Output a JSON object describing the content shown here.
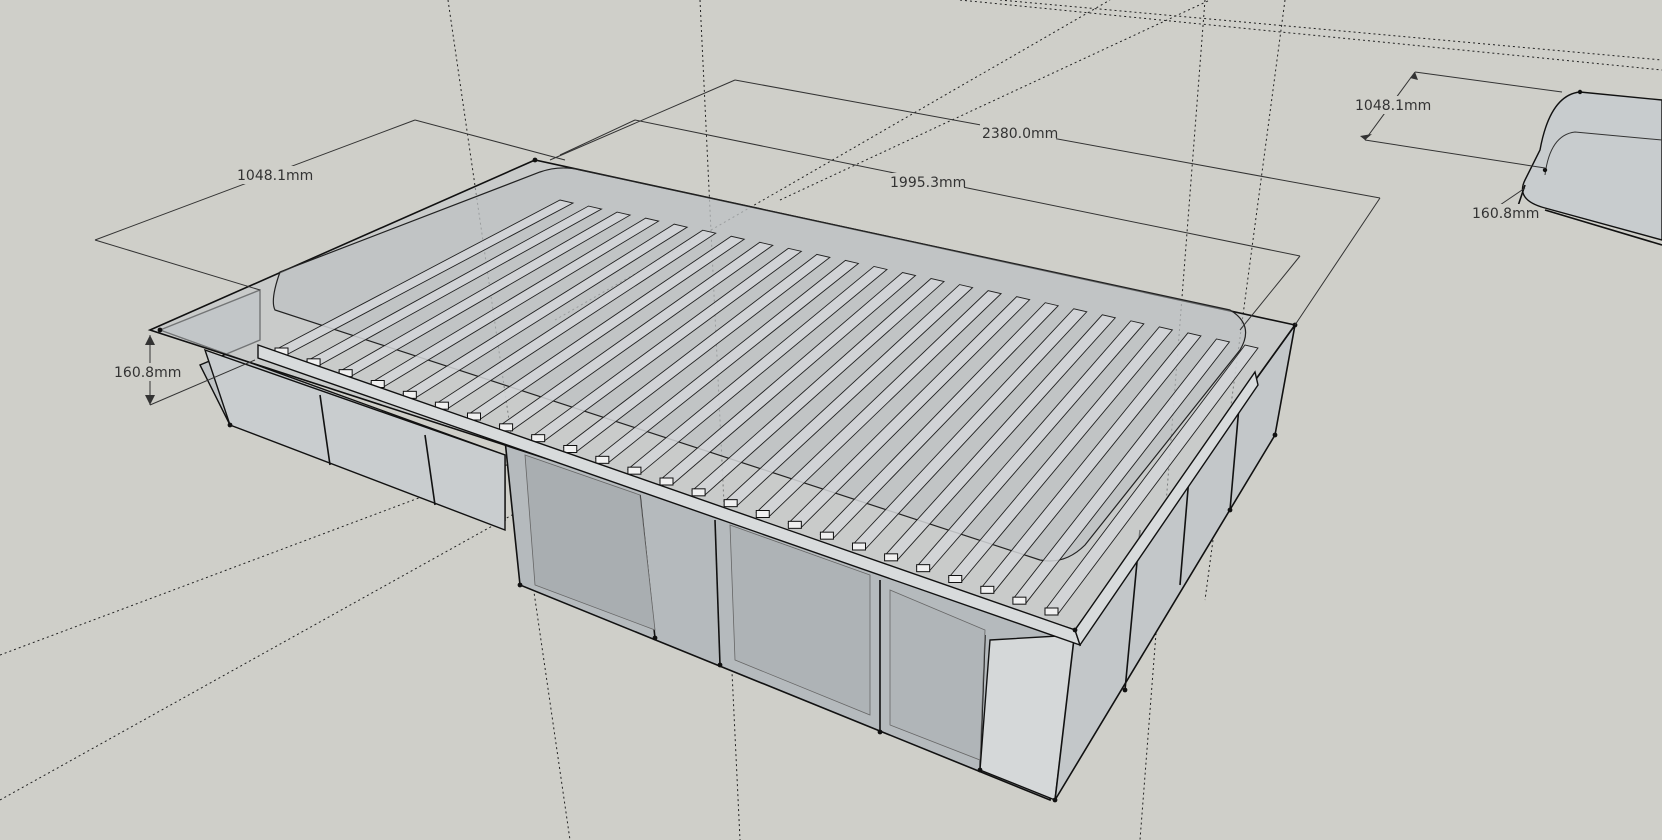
{
  "dimensions": {
    "left_width": "1048.1mm",
    "left_height": "160.8mm",
    "overall_length": "2380.0mm",
    "inner_length": "1995.3mm",
    "right_width": "1048.1mm",
    "right_height": "160.8mm"
  },
  "colors": {
    "background": "#cfcfc9",
    "model_fill": "#b8bcbe",
    "model_light": "#d6d9da",
    "edges": "#111111"
  },
  "model": {
    "slat_count": 25
  }
}
